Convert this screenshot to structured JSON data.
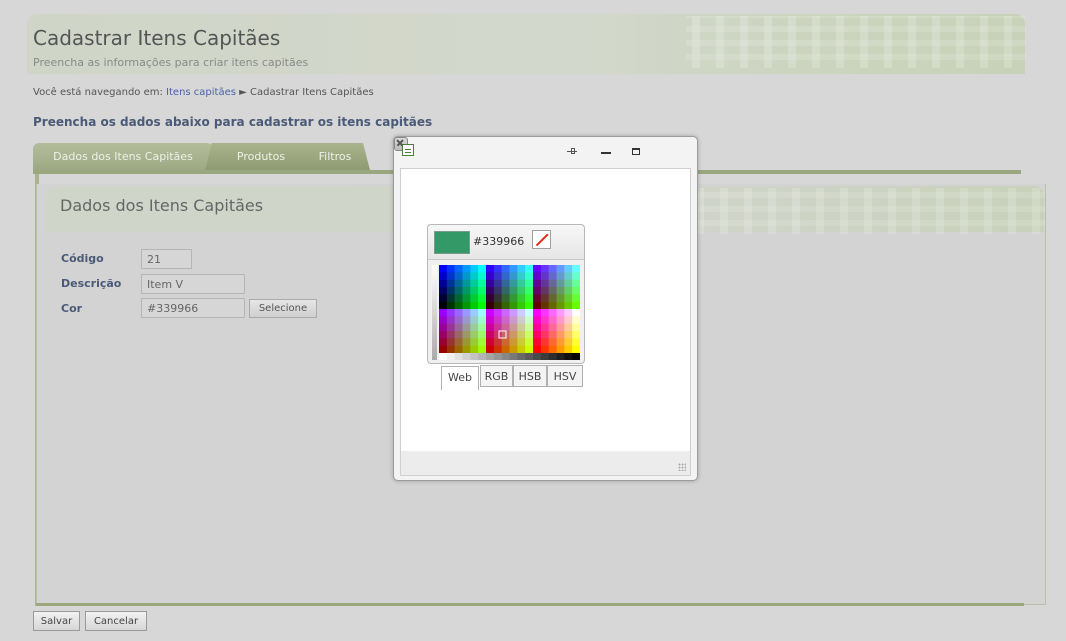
{
  "page": {
    "title": "Cadastrar Itens Capitães",
    "subtitle": "Preencha as informações para criar itens capitães",
    "breadcrumb_prefix": "Você está navegando em:",
    "breadcrumb_link": "Itens capitães",
    "breadcrumb_separator": "►",
    "breadcrumb_current": "Cadastrar Itens Capitães",
    "section_heading": "Preencha os dados abaixo para cadastrar os itens capitães"
  },
  "tabs": [
    {
      "label": "Dados dos Itens Capitães",
      "active": true
    },
    {
      "label": "Produtos",
      "active": false
    },
    {
      "label": "Filtros",
      "active": false
    }
  ],
  "form": {
    "card_title": "Dados dos Itens Capitães",
    "codigo_label": "Código",
    "codigo_value": "21",
    "descricao_label": "Descrição",
    "descricao_value": "Item V",
    "cor_label": "Cor",
    "cor_value": "#339966",
    "select_button": "Selecione"
  },
  "footer": {
    "save": "Salvar",
    "cancel": "Cancelar"
  },
  "color_dialog": {
    "selected_hex": "#339966",
    "selected_color": "#339966",
    "picker_tabs": [
      "Web",
      "RGB",
      "HSB",
      "HSV"
    ],
    "active_picker_tab": "Web"
  }
}
